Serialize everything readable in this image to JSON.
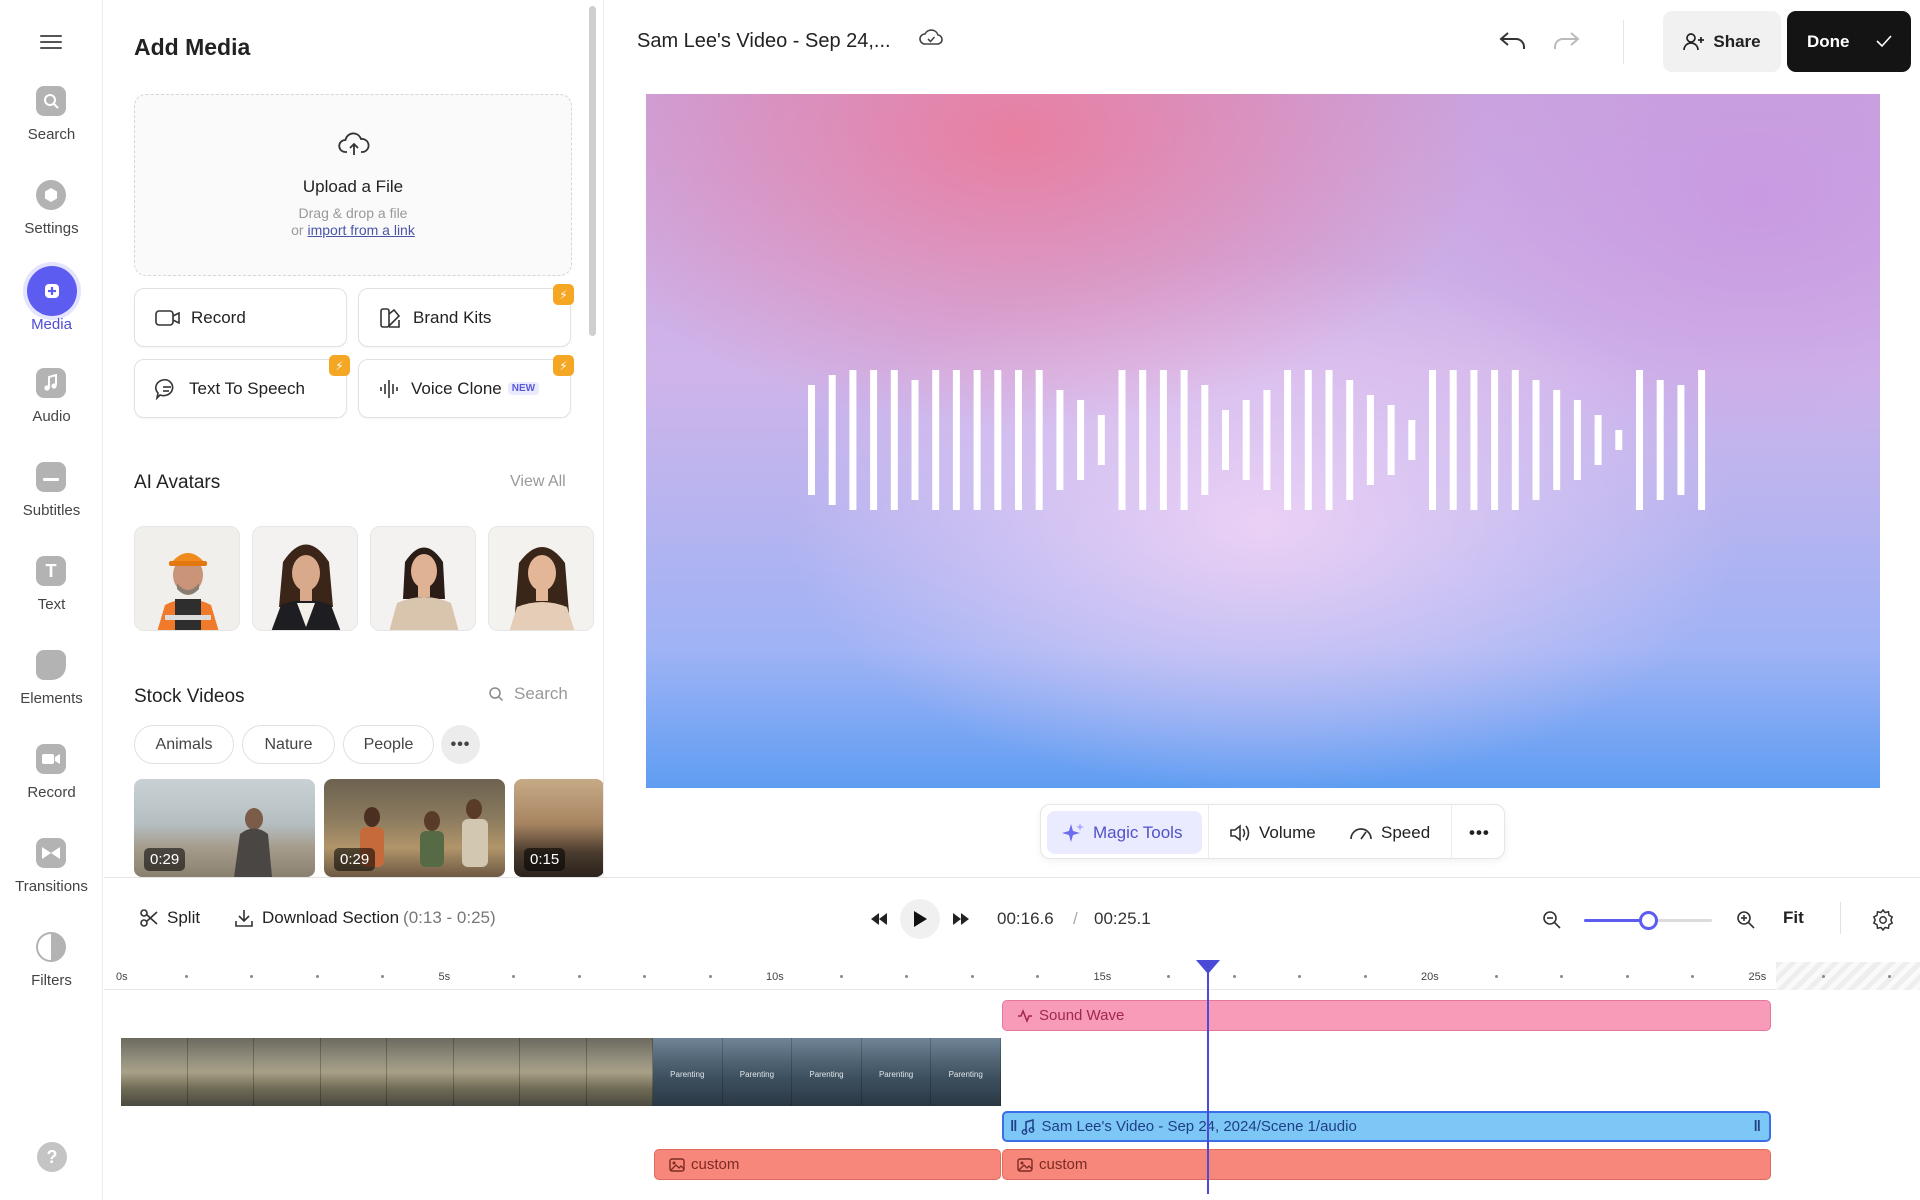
{
  "rail": {
    "items": [
      {
        "label": "Search",
        "icon": "search-icon"
      },
      {
        "label": "Settings",
        "icon": "settings-icon"
      },
      {
        "label": "Media",
        "icon": "plus-icon",
        "active": true
      },
      {
        "label": "Audio",
        "icon": "music-note-icon"
      },
      {
        "label": "Subtitles",
        "icon": "subtitles-icon"
      },
      {
        "label": "Text",
        "icon": "text-icon"
      },
      {
        "label": "Elements",
        "icon": "elements-icon"
      },
      {
        "label": "Record",
        "icon": "camera-icon"
      },
      {
        "label": "Transitions",
        "icon": "transitions-icon"
      },
      {
        "label": "Filters",
        "icon": "filters-icon"
      }
    ],
    "help_glyph": "?"
  },
  "panel": {
    "title": "Add Media",
    "upload": {
      "title": "Upload a File",
      "subtitle": "Drag & drop a file",
      "or": "or",
      "link": "import from a link"
    },
    "tools": {
      "record": "Record",
      "brand_kits": "Brand Kits",
      "text_to_speech": "Text To Speech",
      "voice_clone": "Voice Clone",
      "new_badge": "NEW"
    },
    "avatars": {
      "title": "AI Avatars",
      "view_all": "View All"
    },
    "stock": {
      "title": "Stock Videos",
      "search_placeholder": "Search",
      "chips": [
        "Animals",
        "Nature",
        "People"
      ],
      "videos": [
        {
          "duration": "0:29"
        },
        {
          "duration": "0:29"
        },
        {
          "duration": "0:15"
        }
      ]
    }
  },
  "header": {
    "title": "Sam Lee's Video - Sep 24,...",
    "share": "Share",
    "done": "Done"
  },
  "floatbar": {
    "magic": "Magic Tools",
    "volume": "Volume",
    "speed": "Speed"
  },
  "timeline_toolbar": {
    "split": "Split",
    "download": "Download Section",
    "download_range": "(0:13 - 0:25)",
    "current_time": "00:16.6",
    "separator": "/",
    "total_time": "00:25.1",
    "fit": "Fit",
    "zoom_level": 0.5
  },
  "timeline": {
    "ruler": [
      "0s",
      "5s",
      "10s",
      "15s",
      "20s",
      "25s"
    ],
    "clips": {
      "sound_wave": "Sound Wave",
      "audio": "Sam Lee's Video - Sep 24, 2024/Scene 1/audio",
      "custom_1": "custom",
      "custom_2": "custom",
      "video_frame_label": "Parenting"
    }
  },
  "colors": {
    "accent": "#5d5cf0",
    "done_bg": "#141414",
    "sound_wave": "#f89bb8",
    "audio_clip": "#7dc7f7",
    "custom_clip": "#f7877a",
    "pro_badge": "#f5a623"
  }
}
